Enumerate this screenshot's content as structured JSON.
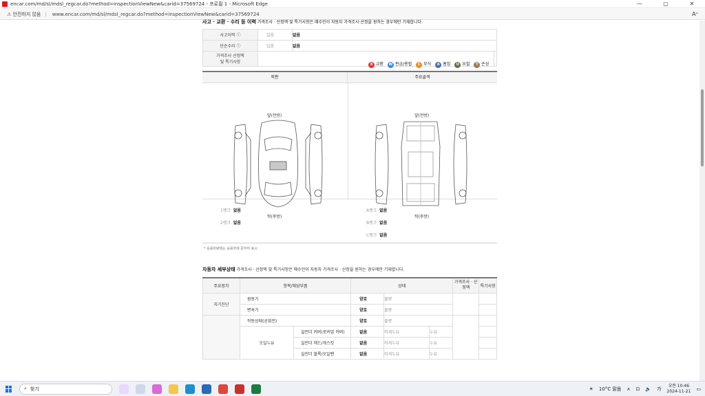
{
  "window": {
    "title": "encar.com/md/sl/mdsl_regcar.do?method=inspectionViewNew&carid=37569724 - 프로필 1 - Microsoft Edge",
    "min": "—",
    "max": "▢",
    "close": "✕"
  },
  "address": {
    "warning": "⚠ 안전하지 않음",
    "url": "www.encar.com/md/sl/mdsl_regcar.do?method=inspectionViewNew&carid=37569724",
    "read_aloud": "Aᴬ"
  },
  "accident": {
    "header_title": "사고 · 교환 · 수리 등 이력",
    "header_note": "가격조사 · 산정액 및 특기사항은 매수인이 자동차 가격조사·산정을 원하는 경우에만 기재합니다.",
    "rows": [
      {
        "label": "사고이력 ⓘ",
        "opt": "있음",
        "value": "없음"
      },
      {
        "label": "단순수리 ⓘ",
        "opt": "있음",
        "value": "없음"
      }
    ],
    "price_label_1": "가격조사 산정액",
    "price_label_2": "및 특기사항"
  },
  "legend": [
    {
      "code": "X",
      "label": "교환",
      "color": "#e8312f"
    },
    {
      "code": "W",
      "label": "판금/용접",
      "color": "#3b8fd8"
    },
    {
      "code": "C",
      "label": "부식",
      "color": "#f08a1c"
    },
    {
      "code": "A",
      "label": "흠집",
      "color": "#4a6fb3"
    },
    {
      "code": "U",
      "label": "요철",
      "color": "#6b6b47"
    },
    {
      "code": "T",
      "label": "손상",
      "color": "#9b7b5b"
    }
  ],
  "diagram": {
    "col1": "외판",
    "col2": "주요골격",
    "front": "앞(전방)",
    "rear": "뒤(후방)",
    "rank1": "1랭크",
    "rank1_val": "없음",
    "rank2": "2랭크",
    "rank2_val": "없음",
    "rankA": "A랭크",
    "rankA_val": "없음",
    "rankB": "B랭크",
    "rankB_val": "없음",
    "rankC": "C랭크",
    "rankC_val": "없음"
  },
  "note": "* 승용차량에는 승용차에 준하여 표시",
  "detail": {
    "title": "자동차 세부상태",
    "note": "가격조사 · 산정액 및 특기사항은 매수인이 자동차 가격조사 · 산정을 원하는 경우에만 기재합니다.",
    "headers": {
      "main": "주요장치",
      "item": "항목/해당부품",
      "state": "상태",
      "price": "가격조사 · 산정액",
      "special": "특기사항"
    },
    "self_diag": "자기진단",
    "engine": "원동기",
    "trans": "변속기",
    "good": "양호",
    "bad": "불량",
    "engine_run": "작동상태(공회전)",
    "oil_leak": "오일누유",
    "oil_items": [
      "실린더 커버(로커암 커버)",
      "실린더 헤드/개스킷",
      "실린더 블록/오일팬"
    ],
    "none": "없음",
    "minor": "미세누유",
    "leak": "누유"
  },
  "taskbar": {
    "search": "찾기",
    "weather": "10°C 맑음",
    "time": "오전 10:46",
    "date": "2024-11-21"
  }
}
